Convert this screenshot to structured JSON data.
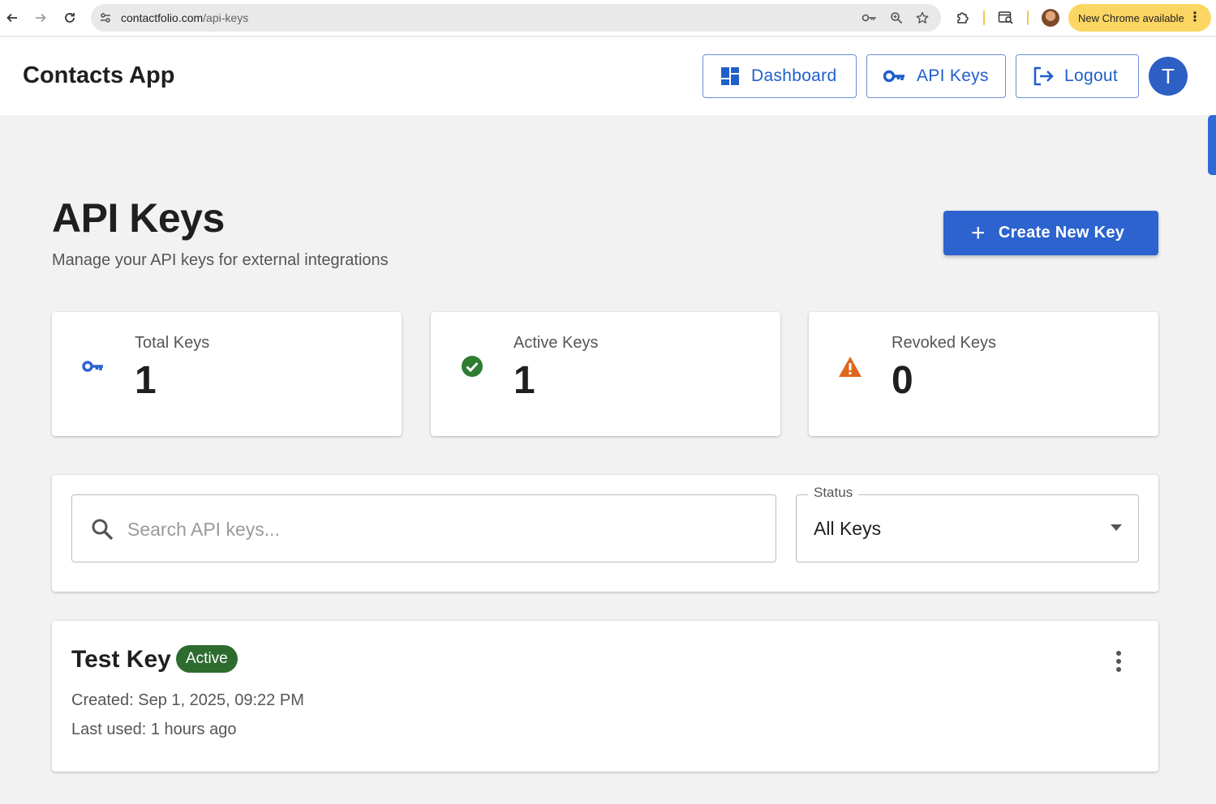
{
  "browser": {
    "url_domain": "contactfolio.com",
    "url_path": "/api-keys",
    "update_label": "New Chrome available"
  },
  "header": {
    "app_title": "Contacts App",
    "nav": {
      "dashboard": "Dashboard",
      "api_keys": "API Keys",
      "logout": "Logout"
    },
    "avatar_initial": "T"
  },
  "page": {
    "title": "API Keys",
    "subtitle": "Manage your API keys for external integrations",
    "create_button": "Create New Key"
  },
  "stats": {
    "total": {
      "label": "Total Keys",
      "value": "1",
      "icon": "key-icon"
    },
    "active": {
      "label": "Active Keys",
      "value": "1",
      "icon": "check-circle-icon"
    },
    "revoked": {
      "label": "Revoked Keys",
      "value": "0",
      "icon": "warning-icon"
    }
  },
  "filters": {
    "search_placeholder": "Search API keys...",
    "status_label": "Status",
    "status_value": "All Keys"
  },
  "keys": [
    {
      "name": "Test Key",
      "status": "Active",
      "created": "Created: Sep 1, 2025, 09:22 PM",
      "last_used": "Last used: 1 hours ago"
    }
  ],
  "colors": {
    "primary": "#2d63cf",
    "active_badge": "#2e6b2f",
    "check_green": "#2e7d32",
    "warning_orange": "#e0661b",
    "update_pill": "#fcd662"
  }
}
